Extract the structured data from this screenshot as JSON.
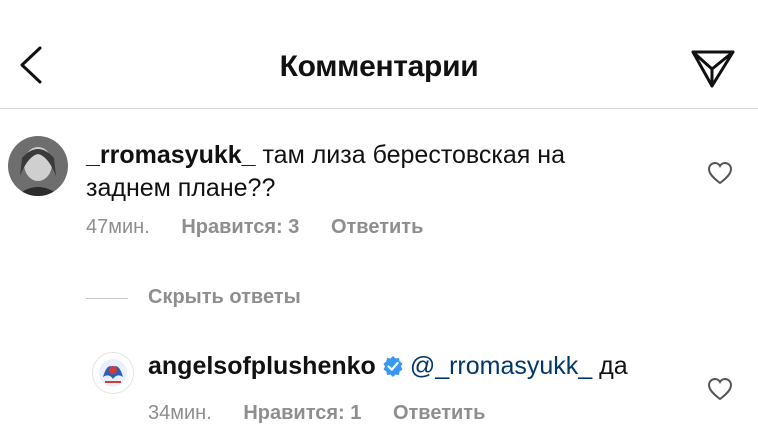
{
  "header": {
    "title": "Комментарии",
    "back_icon": "chevron-left-icon",
    "send_icon": "paper-plane-icon"
  },
  "comment": {
    "username": "_rromasyukk_",
    "text": "там лиза берестовская на заднем плане??",
    "time": "47мин.",
    "likes": "Нравится: 3",
    "reply": "Ответить"
  },
  "hide_replies": "Скрыть ответы",
  "reply_comment": {
    "username": "angelsofplushenko",
    "mention": "@_rromasyukk_",
    "text": "да",
    "time": "34мин.",
    "likes": "Нравится: 1",
    "reply": "Ответить",
    "verified_color": "#3897f0"
  }
}
